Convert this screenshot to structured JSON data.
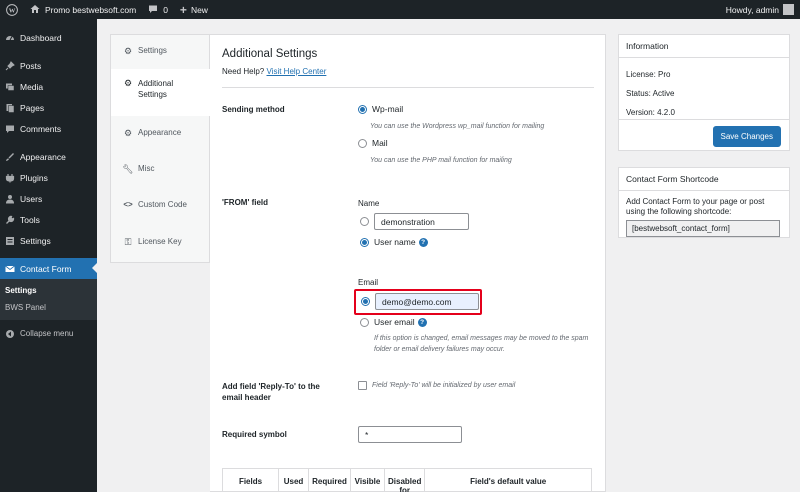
{
  "adminbar": {
    "site_name": "Promo bestwebsoft.com",
    "comments_count": "0",
    "new_label": "New",
    "greeting": "Howdy, admin"
  },
  "sidebar": {
    "items": [
      {
        "label": "Dashboard",
        "icon": "dashboard-icon"
      },
      {
        "label": "Posts",
        "icon": "pin-icon"
      },
      {
        "label": "Media",
        "icon": "media-icon"
      },
      {
        "label": "Pages",
        "icon": "pages-icon"
      },
      {
        "label": "Comments",
        "icon": "comment-icon"
      },
      {
        "label": "Appearance",
        "icon": "brush-icon"
      },
      {
        "label": "Plugins",
        "icon": "plugin-icon"
      },
      {
        "label": "Users",
        "icon": "users-icon"
      },
      {
        "label": "Tools",
        "icon": "wrench-icon"
      },
      {
        "label": "Settings",
        "icon": "settings-icon"
      },
      {
        "label": "Contact Form",
        "icon": "envelope-icon"
      }
    ],
    "submenu": [
      "Settings",
      "BWS Panel"
    ],
    "collapse_label": "Collapse menu"
  },
  "tabs": [
    {
      "label": "Settings",
      "icon": "gear-icon"
    },
    {
      "label": "Additional Settings",
      "icon": "gear-icon"
    },
    {
      "label": "Appearance",
      "icon": "gear-icon"
    },
    {
      "label": "Misc",
      "icon": "wrench-icon"
    },
    {
      "label": "Custom Code",
      "icon": "code-icon"
    },
    {
      "label": "License Key",
      "icon": "key-icon"
    }
  ],
  "main": {
    "title": "Additional Settings",
    "help_prefix": "Need Help?",
    "help_link": "Visit Help Center",
    "sending_method": {
      "label": "Sending method",
      "option_wpmail": "Wp-mail",
      "hint_wpmail": "You can use the Wordpress wp_mail function for mailing",
      "option_mail": "Mail",
      "hint_mail": "You can use the PHP mail function for mailing"
    },
    "from_field": {
      "label": "'FROM' field",
      "name_title": "Name",
      "name_value": "demonstration",
      "username_label": "User name",
      "email_title": "Email",
      "email_value": "demo@demo.com",
      "useremail_label": "User email",
      "hint": "If this option is changed, email messages may be moved to the spam folder or email delivery failures may occur."
    },
    "reply_to": {
      "label": "Add field 'Reply-To' to the email header",
      "hint": "Field 'Reply-To' will be initialized by user email"
    },
    "required_symbol": {
      "label": "Required symbol",
      "value": "*"
    },
    "table_headers": [
      "Fields",
      "Used",
      "Required",
      "Visible",
      "Disabled for",
      "Field's default value"
    ]
  },
  "info_card": {
    "title": "Information",
    "license": "License: Pro",
    "status": "Status: Active",
    "version": "Version: 4.2.0",
    "save_label": "Save Changes"
  },
  "shortcode_card": {
    "title": "Contact Form Shortcode",
    "description": "Add Contact Form to your page or post using the following shortcode:",
    "shortcode": "[bestwebsoft_contact_form]"
  },
  "colors": {
    "accent": "#2271b1",
    "highlight": "#e4001b",
    "menu_bg": "#1d2327"
  }
}
